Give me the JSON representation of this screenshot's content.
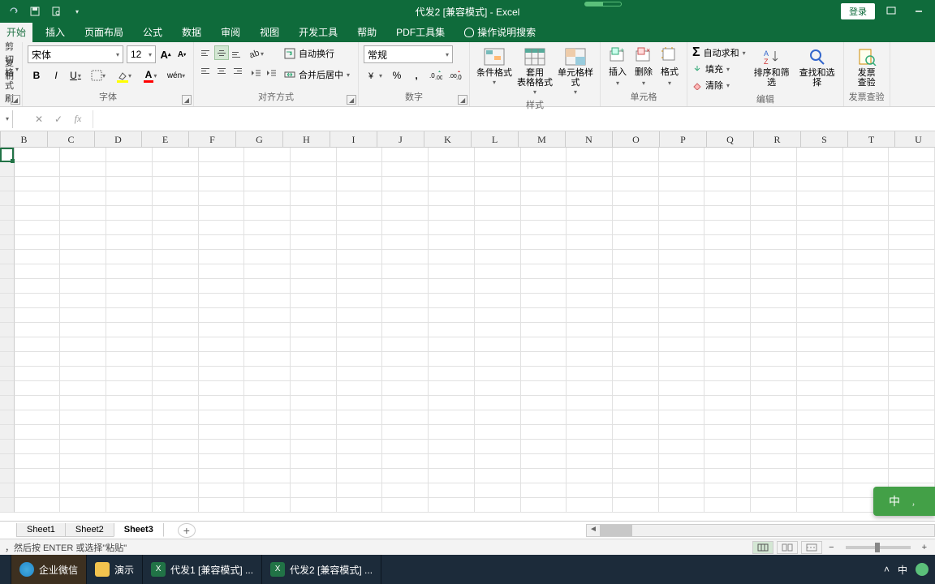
{
  "title": "代发2  [兼容模式]  -  Excel",
  "login": "登录",
  "tabs": {
    "start": "开始",
    "insert": "插入",
    "layout": "页面布局",
    "formula": "公式",
    "data": "数据",
    "review": "审阅",
    "view": "视图",
    "dev": "开发工具",
    "help": "帮助",
    "pdf": "PDF工具集",
    "tellme": "操作说明搜索"
  },
  "clipboard": {
    "cut": "剪切",
    "copy": "复制",
    "paint": "格式刷"
  },
  "font": {
    "name": "宋体",
    "size": "12",
    "label": "字体"
  },
  "align": {
    "wrap": "自动换行",
    "merge": "合并后居中",
    "label": "对齐方式"
  },
  "number": {
    "format": "常规",
    "label": "数字"
  },
  "styles": {
    "cond": "条件格式",
    "table": "套用\n表格格式",
    "cell": "单元格样式",
    "label": "样式"
  },
  "cells": {
    "insert": "插入",
    "delete": "删除",
    "format": "格式",
    "label": "单元格"
  },
  "editing": {
    "sum": "自动求和",
    "fill": "填充",
    "clear": "清除",
    "label": "编辑"
  },
  "find": {
    "sort": "排序和筛选",
    "find": "查找和选择"
  },
  "invoice": {
    "check": "发票\n查验",
    "label": "发票查验"
  },
  "columns": [
    "B",
    "C",
    "D",
    "E",
    "F",
    "G",
    "H",
    "I",
    "J",
    "K",
    "L",
    "M",
    "N",
    "O",
    "P",
    "Q",
    "R",
    "S",
    "T",
    "U"
  ],
  "sheets": [
    "Sheet1",
    "Sheet2",
    "Sheet3"
  ],
  "active_sheet": 2,
  "status": "，然后按 ENTER 或选择\"粘贴\"",
  "ime": {
    "lang": "中",
    "punct": "，"
  },
  "taskbar": {
    "wechat": "企业微信",
    "demo": "演示",
    "file1": "代发1  [兼容模式]  ...",
    "file2": "代发2  [兼容模式]  ..."
  },
  "tray": {
    "lang": "中"
  }
}
